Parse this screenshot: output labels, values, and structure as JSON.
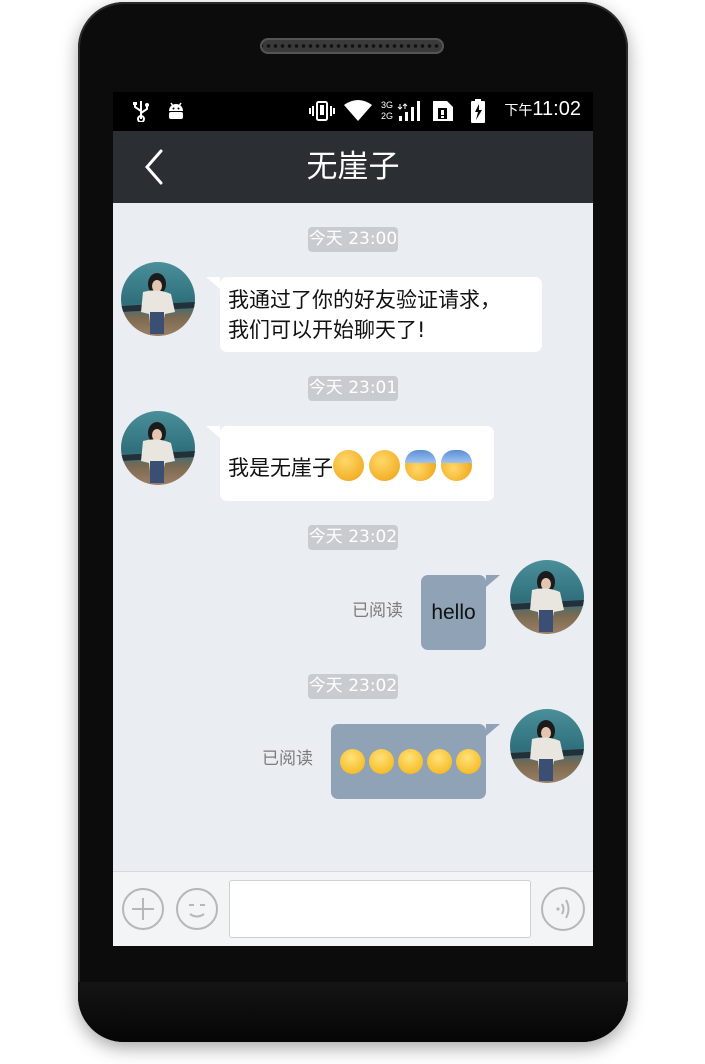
{
  "status_bar": {
    "left_icons": [
      "usb-icon",
      "android-debug-icon"
    ],
    "right_icons": [
      "vibrate-icon",
      "wifi-icon",
      "mobile-data-icon",
      "sim-icon",
      "battery-charging-icon"
    ],
    "network_labels": [
      "3G",
      "2G"
    ],
    "ampm": "下午",
    "time": "11:02"
  },
  "header": {
    "title": "无崖子",
    "back_icon": "back-chevron-icon"
  },
  "messages": [
    {
      "timestamp": "今天 23:00",
      "side": "incoming",
      "lines": [
        "我通过了你的好友验证请求，",
        "我们可以开始聊天了!"
      ]
    },
    {
      "timestamp": "今天 23:01",
      "side": "incoming",
      "text": "我是无崖子",
      "emojis": [
        "smirk-emoji",
        "smirk-emoji",
        "fearful-emoji",
        "fearful-emoji"
      ]
    },
    {
      "timestamp": "今天 23:02",
      "side": "outgoing",
      "text": "hello",
      "read_label": "已阅读"
    },
    {
      "timestamp": "今天 23:02",
      "side": "outgoing",
      "emojis": [
        "kiss-emoji",
        "kiss-emoji",
        "tongue-emoji",
        "tongue-emoji",
        "wink-emoji"
      ],
      "read_label": "已阅读"
    }
  ],
  "input_bar": {
    "plus_icon": "plus-icon",
    "emoji_icon": "emoji-face-icon",
    "text_value": "",
    "voice_icon": "voice-icon"
  },
  "colors": {
    "title_bar": "#2b2e33",
    "chat_background": "#eaedf1",
    "outgoing_bubble": "#8fa2b6",
    "incoming_bubble": "#ffffff",
    "timestamp_badge": "#c8ccd1"
  }
}
